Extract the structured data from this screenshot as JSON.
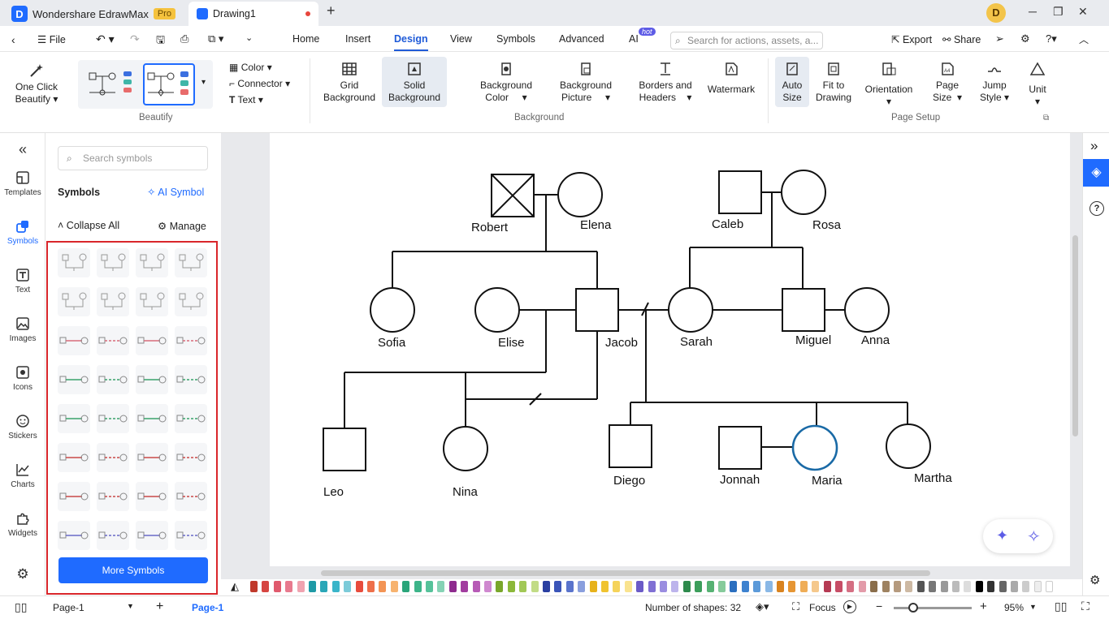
{
  "titlebar": {
    "app_name": "Wondershare EdrawMax",
    "badge": "Pro",
    "doc_tab": "Drawing1",
    "user_initial": "D",
    "accent": "#1f6bff"
  },
  "menubar": {
    "file": "File",
    "tabs": [
      "Home",
      "Insert",
      "Design",
      "View",
      "Symbols",
      "Advanced",
      "AI"
    ],
    "active_tab": "Design",
    "ai_badge": "hot",
    "search_placeholder": "Search for actions, assets, a...",
    "export": "Export",
    "share": "Share"
  },
  "ribbon": {
    "one_click": "One Click",
    "beautify": "Beautify",
    "color": "Color",
    "connector": "Connector",
    "text": "Text",
    "group_beautify": "Beautify",
    "grid_1": "Grid",
    "grid_2": "Background",
    "solid_1": "Solid",
    "solid_2": "Background",
    "bgcolor_1": "Background",
    "bgcolor_2": "Color",
    "bgpic_1": "Background",
    "bgpic_2": "Picture",
    "borders_1": "Borders and",
    "borders_2": "Headers",
    "watermark": "Watermark",
    "group_background": "Background",
    "autosize_1": "Auto",
    "autosize_2": "Size",
    "fit_1": "Fit to",
    "fit_2": "Drawing",
    "orientation": "Orientation",
    "pagesize_1": "Page",
    "pagesize_2": "Size",
    "jump_1": "Jump",
    "jump_2": "Style",
    "unit": "Unit",
    "group_pagesetup": "Page Setup"
  },
  "rail": {
    "items": [
      "Templates",
      "Symbols",
      "Text",
      "Images",
      "Icons",
      "Stickers",
      "Charts",
      "Widgets"
    ],
    "active": "Symbols"
  },
  "panel": {
    "search_placeholder": "Search symbols",
    "title": "Symbols",
    "ai_symbol": "AI Symbol",
    "collapse_all": "Collapse All",
    "manage": "Manage",
    "more_symbols": "More Symbols"
  },
  "diagram": {
    "names": {
      "robert": "Robert",
      "elena": "Elena",
      "caleb": "Caleb",
      "rosa": "Rosa",
      "sofia": "Sofia",
      "elise": "Elise",
      "jacob": "Jacob",
      "sarah": "Sarah",
      "miguel": "Miguel",
      "anna": "Anna",
      "leo": "Leo",
      "nina": "Nina",
      "diego": "Diego",
      "jonnah": "Jonnah",
      "maria": "Maria",
      "martha": "Martha"
    },
    "highlight_color": "#1a6aa6"
  },
  "statusbar": {
    "page_select": "Page-1",
    "page_tab": "Page-1",
    "shapes": "Number of shapes: 32",
    "focus": "Focus",
    "zoom": "95%"
  },
  "palette": [
    "#c0392b",
    "#d64541",
    "#e05a6d",
    "#e87a8e",
    "#f0a3b0",
    "#1f9aa6",
    "#2aa7b8",
    "#3ab5c9",
    "#7ccbd9",
    "#e84c3d",
    "#ee6f4a",
    "#f39455",
    "#f7b36f",
    "#2aa57a",
    "#3db489",
    "#56c29a",
    "#86d3b5",
    "#8e2b8e",
    "#a23d9f",
    "#b75bb6",
    "#cf88cf",
    "#7aa72b",
    "#8cb83a",
    "#a2c856",
    "#c2dc86",
    "#2a3fa1",
    "#3b55b8",
    "#5a74cc",
    "#8a9fdd",
    "#e7b21b",
    "#f0c330",
    "#f5d35a",
    "#f9e38f",
    "#6b5bc7",
    "#8070d4",
    "#9a8de0",
    "#bdb4ec",
    "#2e8a4c",
    "#3c9e5b",
    "#56b273",
    "#86cb9b",
    "#2b6fbf",
    "#3d82cf",
    "#5c9ad9",
    "#8ab8e6",
    "#d9831f",
    "#e69634",
    "#efad57",
    "#f5c88c",
    "#b53a53",
    "#c74d66",
    "#d56f83",
    "#e39ba9",
    "#8a6e4b",
    "#9e8261",
    "#b59a7e",
    "#cdb9a3",
    "#555555",
    "#777777",
    "#999999",
    "#bbbbbb",
    "#dddddd",
    "#000000",
    "#333333",
    "#666666",
    "#aaaaaa",
    "#cccccc",
    "#eeeeee",
    "#ffffff"
  ]
}
